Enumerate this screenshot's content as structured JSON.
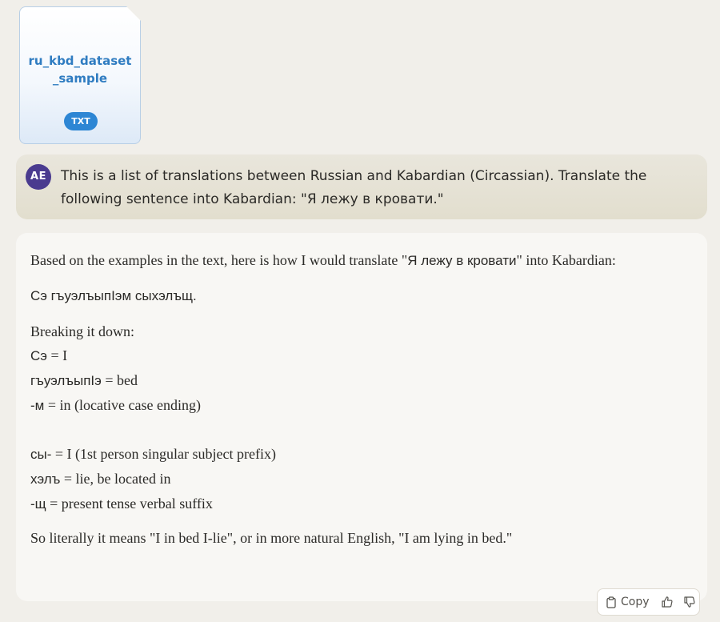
{
  "attachment": {
    "file_name": "ru_kbd_dataset_sample",
    "file_type": "TXT"
  },
  "user_message": {
    "avatar_initials": "AE",
    "text": "This is a list of translations between Russian and Kabardian (Circassian). Translate the following sentence into Kabardian: \"Я лежу в кровати.\""
  },
  "assistant_message": {
    "intro_part1": "Based on the examples in the text, here is how I would translate \"",
    "intro_ru": "Я лежу в кровати",
    "intro_part2": "\" into Kabardian:",
    "translation": "Сэ гъуэлъыпIэм сыхэлъщ.",
    "breakdown_heading": "Breaking it down:",
    "breakdown": [
      {
        "term": "Сэ",
        "meaning": " = I"
      },
      {
        "term": "гъуэлъыпIэ",
        "meaning": " = bed"
      },
      {
        "term": "-м",
        "meaning": " = in (locative case ending)"
      },
      {
        "term": "сы-",
        "meaning": " = I (1st person singular subject prefix)"
      },
      {
        "term": "хэлъ",
        "meaning": " = lie, be located in"
      },
      {
        "term": "-щ",
        "meaning": " = present tense verbal suffix"
      }
    ],
    "conclusion": "So literally it means \"I in bed I-lie\", or in more natural English, \"I am lying in bed.\""
  },
  "actions": {
    "copy_label": "Copy",
    "copy_icon": "clipboard-icon",
    "thumbs_up_icon": "thumbs-up-icon",
    "thumbs_down_icon": "thumbs-down-icon"
  },
  "colors": {
    "background": "#f1efea",
    "file_accent": "#2d86d4",
    "avatar": "#4a3b8f",
    "user_bubble": "#e6e2d6",
    "assistant_bubble": "#f8f7f4"
  }
}
